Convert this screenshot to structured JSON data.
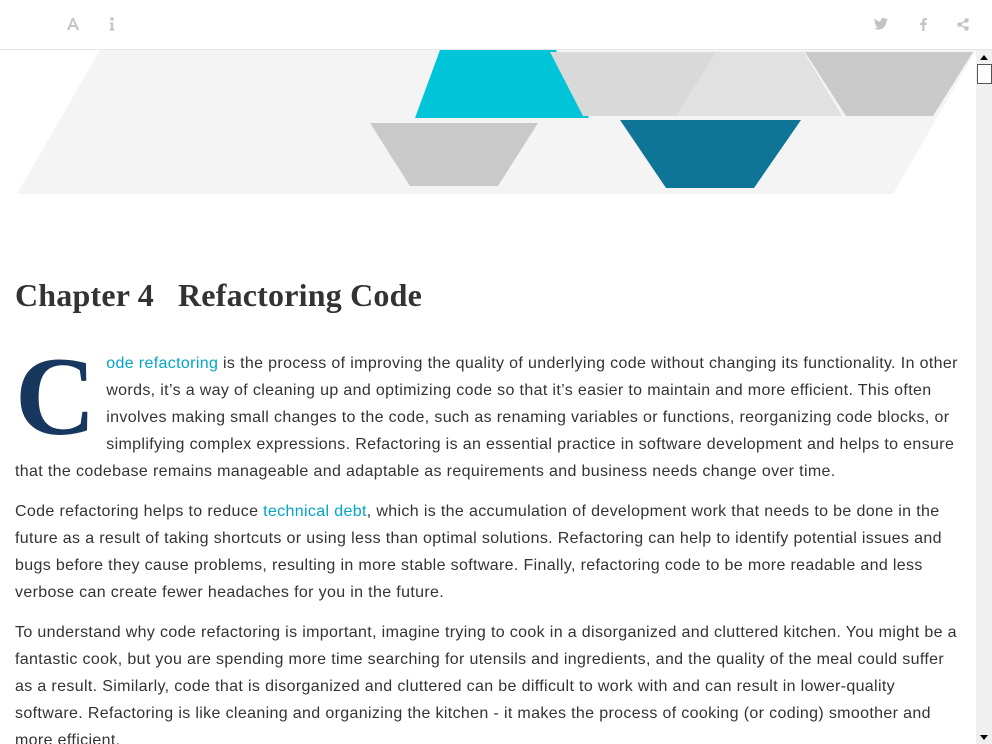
{
  "toolbar": {
    "left_icons": [
      "font-size-icon",
      "info-icon"
    ],
    "right_icons": [
      "twitter-icon",
      "facebook-icon",
      "share-icon"
    ]
  },
  "chapter": {
    "number": "Chapter 4",
    "title": "Refactoring Code"
  },
  "paragraphs": {
    "p1": {
      "dropcap": "C",
      "link": "ode refactoring",
      "text": " is the process of improving the quality of underlying code without changing its functionality. In other words, it’s a way of cleaning up and optimizing code so that it’s easier to maintain and more efficient. This often involves making small changes to the code, such as renaming variables or functions, reorganizing code blocks, or simplifying complex expressions. Refactoring is an essential practice in software development and helps to ensure that the codebase remains manageable and adaptable as requirements and business needs change over time."
    },
    "p2": {
      "before": "Code refactoring helps to reduce ",
      "link": "technical debt",
      "after": ", which is the accumulation of development work that needs to be done in the future as a result of taking shortcuts or using less than optimal solutions. Refactoring can help to identify potential issues and bugs before they cause problems, resulting in more stable software. Finally, refactoring code to be more readable and less verbose can create fewer headaches for you in the future."
    },
    "p3": {
      "text": "To understand why code refactoring is important, imagine trying to cook in a disorganized and cluttered kitchen. You might be a fantastic cook, but you are spending more time searching for utensils and ingredients, and the quality of the meal could suffer as a result. Similarly, code that is disorganized and cluttered can be difficult to work with and can result in lower-quality software. Refactoring is like cleaning and organizing the kitchen - it makes the process of cooking (or coding) smoother and more efficient."
    }
  },
  "colors": {
    "link": "#00a5c8",
    "dropcap": "#17375e",
    "banner_cyan": "#00c4d8",
    "banner_teal": "#0e7596",
    "banner_gray": "#c9c9c9",
    "banner_light": "#f4f4f4",
    "toolbar_icon": "#c4c4c4"
  }
}
